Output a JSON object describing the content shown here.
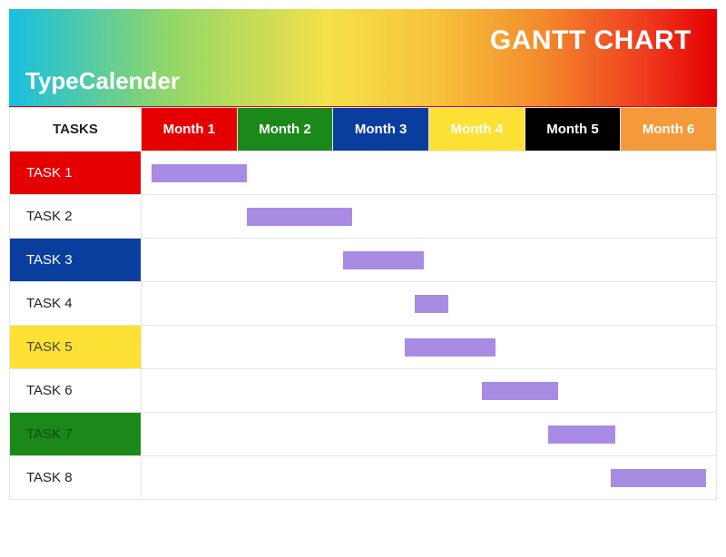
{
  "header": {
    "title": "GANTT CHART",
    "brand": "TypeCalender"
  },
  "columns": {
    "tasks_header": "TASKS",
    "months": [
      "Month 1",
      "Month 2",
      "Month 3",
      "Month 4",
      "Month 5",
      "Month 6"
    ]
  },
  "month_colors": [
    "#e40000",
    "#1a891a",
    "#0a3e9e",
    "#fee135",
    "#000000",
    "#f59a3b"
  ],
  "tasks": [
    {
      "label": "TASK 1",
      "label_bg": "#e40000",
      "label_fg": "#ffffff"
    },
    {
      "label": "TASK 2",
      "label_bg": "#ffffff",
      "label_fg": "#222222"
    },
    {
      "label": "TASK 3",
      "label_bg": "#0a3e9e",
      "label_fg": "#ffffff"
    },
    {
      "label": "TASK 4",
      "label_bg": "#ffffff",
      "label_fg": "#222222"
    },
    {
      "label": "TASK 5",
      "label_bg": "#fee135",
      "label_fg": "#444444"
    },
    {
      "label": "TASK 6",
      "label_bg": "#ffffff",
      "label_fg": "#222222"
    },
    {
      "label": "TASK 7",
      "label_bg": "#1a891a",
      "label_fg": "#18521a"
    },
    {
      "label": "TASK 8",
      "label_bg": "#ffffff",
      "label_fg": "#222222"
    }
  ],
  "chart_data": {
    "type": "bar",
    "title": "GANTT CHART",
    "xlabel": "Month",
    "ylabel": "Task",
    "categories": [
      "Month 1",
      "Month 2",
      "Month 3",
      "Month 4",
      "Month 5",
      "Month 6"
    ],
    "series": [
      {
        "name": "TASK 1",
        "start": 1.1,
        "end": 2.1
      },
      {
        "name": "TASK 2",
        "start": 2.1,
        "end": 3.2
      },
      {
        "name": "TASK 3",
        "start": 3.1,
        "end": 3.95
      },
      {
        "name": "TASK 4",
        "start": 3.85,
        "end": 4.2
      },
      {
        "name": "TASK 5",
        "start": 3.75,
        "end": 4.7
      },
      {
        "name": "TASK 6",
        "start": 4.55,
        "end": 5.35
      },
      {
        "name": "TASK 7",
        "start": 5.25,
        "end": 5.95
      },
      {
        "name": "TASK 8",
        "start": 5.9,
        "end": 6.9
      }
    ],
    "xlim": [
      1,
      7
    ],
    "bar_color": "#a88ce3"
  }
}
